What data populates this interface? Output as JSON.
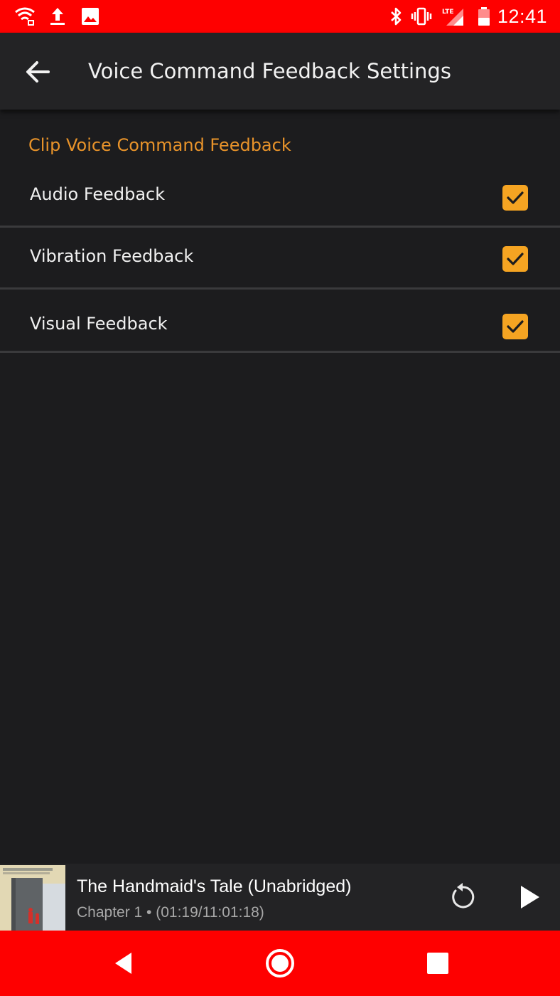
{
  "status_bar": {
    "time": "12:41",
    "background_color": "#fe0000",
    "left_icons": [
      "wifi-upload-icon",
      "upload-icon",
      "image-icon"
    ],
    "right_icons": [
      "bluetooth-icon",
      "vibrate-icon",
      "lte-signal-icon",
      "battery-icon"
    ]
  },
  "app_bar": {
    "title": "Voice Command Feedback Settings",
    "back_icon": "arrow-back-icon"
  },
  "settings": {
    "section_header": "Clip Voice Command Feedback",
    "accent_color": "#e8932a",
    "items": [
      {
        "label": "Audio Feedback",
        "checked": true
      },
      {
        "label": "Vibration Feedback",
        "checked": true
      },
      {
        "label": "Visual Feedback",
        "checked": true
      }
    ]
  },
  "mini_player": {
    "title": "The Handmaid's Tale (Unabridged)",
    "subtitle": "Chapter 1 • (01:19/11:01:18)",
    "replay_icon": "replay-icon",
    "play_icon": "play-icon"
  },
  "nav_bar": {
    "background_color": "#fe0000",
    "buttons": [
      "nav-back-icon",
      "nav-home-icon",
      "nav-recents-icon"
    ]
  }
}
